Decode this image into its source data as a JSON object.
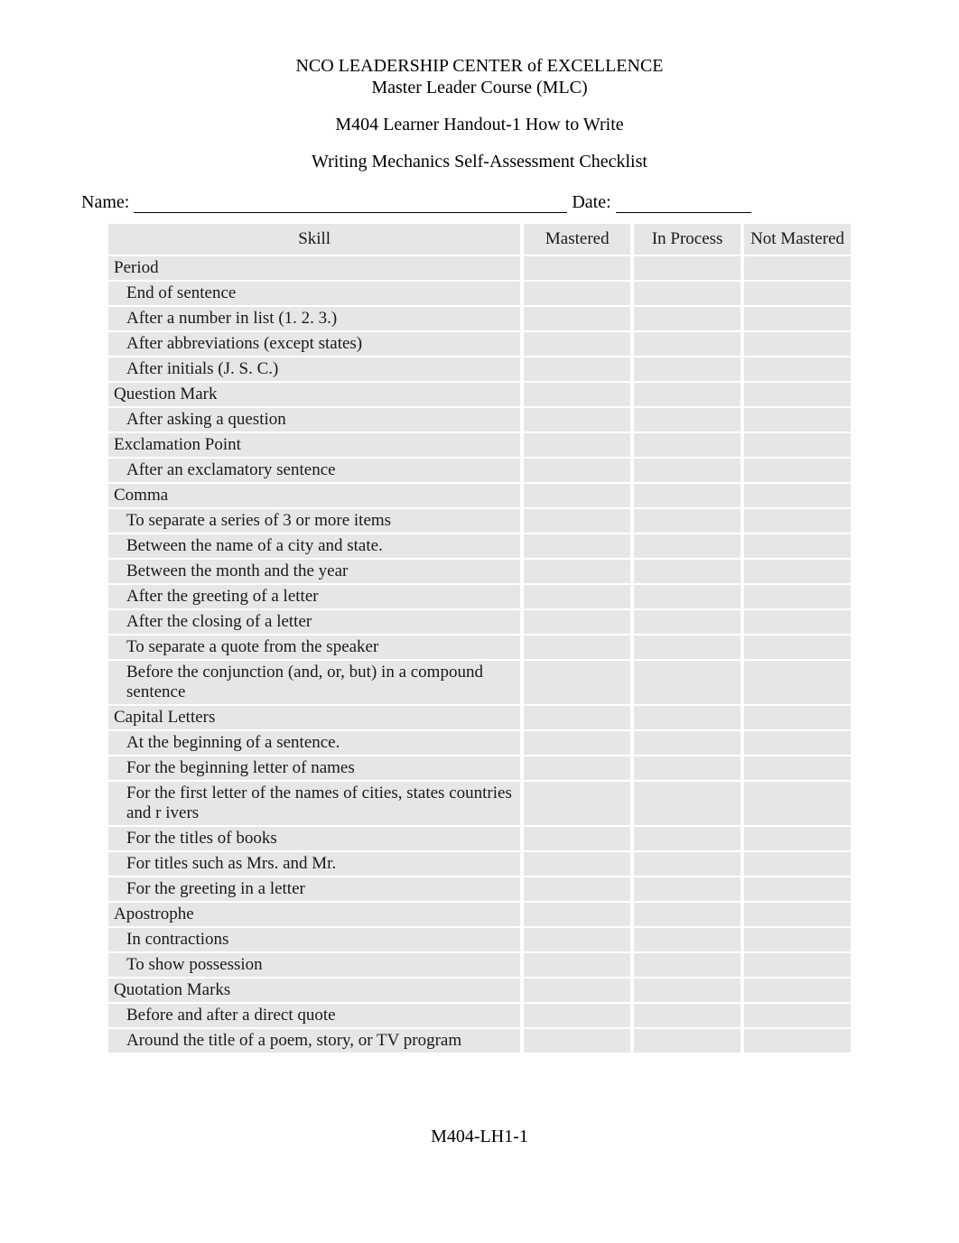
{
  "header": {
    "line1": "NCO LEADERSHIP CENTER of EXCELLENCE",
    "line2": "Master Leader Course (MLC)",
    "handout": "M404 Learner Handout-1 How to Write",
    "checklist_title": "Writing Mechanics Self-Assessment Checklist"
  },
  "form": {
    "name_label": "Name:",
    "date_label": "Date:"
  },
  "table": {
    "headers": {
      "skill": "Skill",
      "mastered": "Mastered",
      "in_process": "In Process",
      "not_mastered": "Not Mastered"
    },
    "rows": [
      {
        "type": "cat",
        "text": "Period"
      },
      {
        "type": "sub",
        "text": "End of sentence"
      },
      {
        "type": "sub",
        "text": "After a number in list (1. 2. 3.)"
      },
      {
        "type": "sub",
        "text": "After abbreviations (except states)"
      },
      {
        "type": "sub",
        "text": "After initials (J. S. C.)"
      },
      {
        "type": "cat",
        "text": "Question Mark"
      },
      {
        "type": "sub",
        "text": "After asking a question"
      },
      {
        "type": "cat",
        "text": "Exclamation Point"
      },
      {
        "type": "sub",
        "text": "After an exclamatory sentence"
      },
      {
        "type": "cat",
        "text": "Comma"
      },
      {
        "type": "sub",
        "text": "To separate a series of 3 or more items"
      },
      {
        "type": "sub",
        "text": "Between the name of a city and state."
      },
      {
        "type": "sub",
        "text": "Between the month and the year"
      },
      {
        "type": "sub",
        "text": "After the greeting of a letter"
      },
      {
        "type": "sub",
        "text": "After the closing of a letter"
      },
      {
        "type": "sub",
        "text": "To separate a quote from the speaker"
      },
      {
        "type": "sub",
        "text": "Before the conjunction (and, or, but) in a compound sentence"
      },
      {
        "type": "cat",
        "text": "Capital Letters"
      },
      {
        "type": "sub",
        "text": "At the beginning of a sentence."
      },
      {
        "type": "sub",
        "text": "For the beginning letter of names"
      },
      {
        "type": "sub",
        "text": "For the first letter of the names of cities, states countries and r ivers"
      },
      {
        "type": "sub",
        "text": "For the titles of books"
      },
      {
        "type": "sub",
        "text": "For titles such as Mrs. and Mr."
      },
      {
        "type": "sub",
        "text": "For the greeting in a letter"
      },
      {
        "type": "cat",
        "text": "Apostrophe"
      },
      {
        "type": "sub",
        "text": "In contractions"
      },
      {
        "type": "sub",
        "text": "To show possession"
      },
      {
        "type": "cat",
        "text": "Quotation Marks"
      },
      {
        "type": "sub",
        "text": "Before and after a direct quote"
      },
      {
        "type": "sub",
        "text": "Around the title of a poem, story, or TV program"
      }
    ]
  },
  "footer": "M404-LH1-1"
}
